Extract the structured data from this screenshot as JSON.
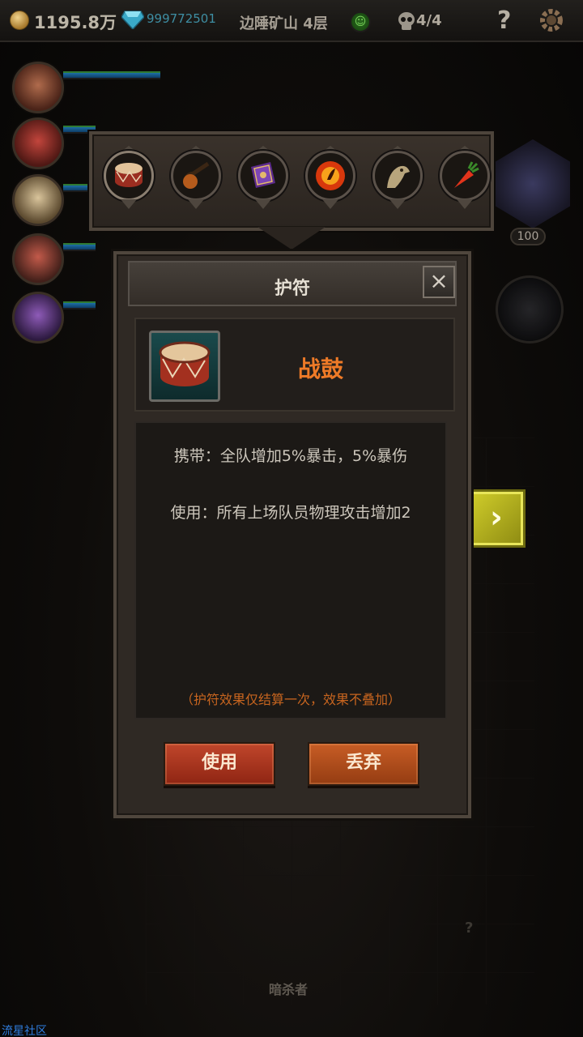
{
  "topbar": {
    "gold": "1195.8万",
    "gems": "999772501",
    "zone": "边陲矿山 4层",
    "kills": "4/4",
    "help_icon": "?"
  },
  "right": {
    "level": "100",
    "next_arrow": "›"
  },
  "item_bar": {
    "slots": [
      {
        "name": "drum-icon",
        "selected": true
      },
      {
        "name": "pipe-icon",
        "selected": false
      },
      {
        "name": "spellbook-icon",
        "selected": false
      },
      {
        "name": "fire-orb-icon",
        "selected": false
      },
      {
        "name": "griffin-icon",
        "selected": false
      },
      {
        "name": "carrot-icon",
        "selected": false
      }
    ]
  },
  "dialog": {
    "title": "护符",
    "close": "×",
    "item_name": "战鼓",
    "carry_desc": "携带：全队增加5%暴击，5%暴伤",
    "use_desc": "使用：所有上场队员物理攻击增加2",
    "note": "（护符效果仅结算一次，效果不叠加）",
    "use_button": "使用",
    "discard_button": "丢弃"
  },
  "bottom": {
    "hero_name": "暗杀者",
    "question": "?"
  },
  "watermark": "流星社区",
  "colors": {
    "accent_orange": "#ee7a27",
    "note_orange": "#c8651f",
    "use_red": "#c0462b",
    "drop_orange": "#c85d25",
    "arrow_yellow": "#d2cf2b"
  }
}
